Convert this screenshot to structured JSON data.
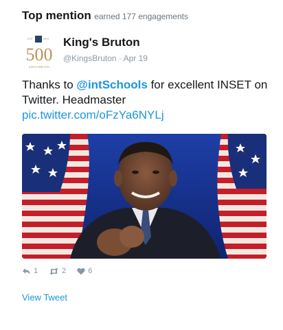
{
  "header": {
    "title": "Top mention",
    "subtitle": "earned 177 engagements"
  },
  "author": {
    "name": "King's Bruton",
    "handle": "@KingsBruton",
    "separator": "·",
    "date": "Apr 19",
    "logo": {
      "number": "500",
      "year_left": "1519",
      "year_right": "2019",
      "caption": "KING'S BRUTON",
      "color": "#b8955a"
    }
  },
  "tweet": {
    "text_before": "Thanks to ",
    "mention": "@intSchools",
    "text_after": " for excellent INSET on Twitter. Headmaster",
    "link": "pic.twitter.com/oFzYa6NYLj"
  },
  "media": {
    "icon": "person-clapping-image"
  },
  "actions": {
    "reply_count": "1",
    "retweet_count": "2",
    "like_count": "6"
  },
  "footer": {
    "view_tweet": "View Tweet"
  },
  "colors": {
    "link": "#1b95e0",
    "muted": "#8899a6",
    "text": "#14171a"
  }
}
